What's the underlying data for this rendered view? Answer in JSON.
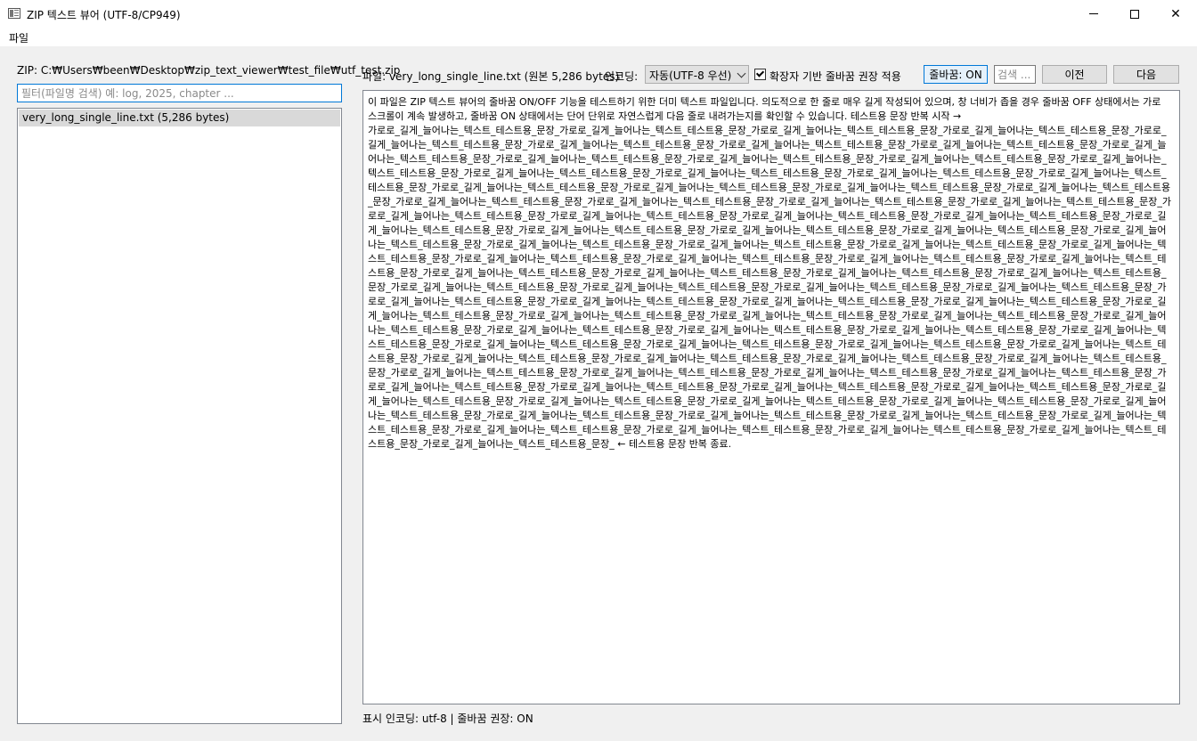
{
  "window": {
    "title": "ZIP 텍스트 뷰어 (UTF-8/CP949)"
  },
  "menu": {
    "file": "파일"
  },
  "left_panel": {
    "zip_path": "ZIP: C:₩Users₩been₩Desktop₩zip_text_viewer₩test_file₩utf_test.zip",
    "filter_placeholder": "필터(파일명 검색) 예: log, 2025, chapter ...",
    "filter_value": "",
    "files": [
      {
        "label": "very_long_single_line.txt  (5,286 bytes)"
      }
    ]
  },
  "toolbar": {
    "file_info": "파일: very_long_single_line.txt  (원본 5,286 bytes)",
    "encoding_label": "인코딩:",
    "encoding_selected": "자동(UTF-8 우선)",
    "ext_wrap_checked": true,
    "ext_wrap_label": "확장자 기반 줄바꿈 권장 적용",
    "wrap_button": "줄바꿈: ON",
    "search_placeholder": "검색 ...",
    "prev_button": "이전",
    "next_button": "다음"
  },
  "content": {
    "intro": "이 파일은 ZIP 텍스트 뷰어의 줄바꿈 ON/OFF 기능을 테스트하기 위한 더미 텍스트 파일입니다. 의도적으로 한 줄로 매우 길게 작성되어 있으며, 창 너비가 좁을 경우 줄바꿈 OFF 상태에서는 가로 스크롤이 계속 발생하고, 줄바꿈 ON 상태에서는 단어 단위로 자연스럽게 다음 줄로 내려가는지를 확인할 수 있습니다. 테스트용 문장 반복 시작 →",
    "repeat_unit": "가로로_길게_늘어나는_텍스트_테스트용_문장_",
    "repeat_count": 93,
    "outro": "← 테스트용 문장 반복 종료."
  },
  "status": {
    "text": "표시 인코딩: utf-8 | 줄바꿈 권장: ON"
  }
}
